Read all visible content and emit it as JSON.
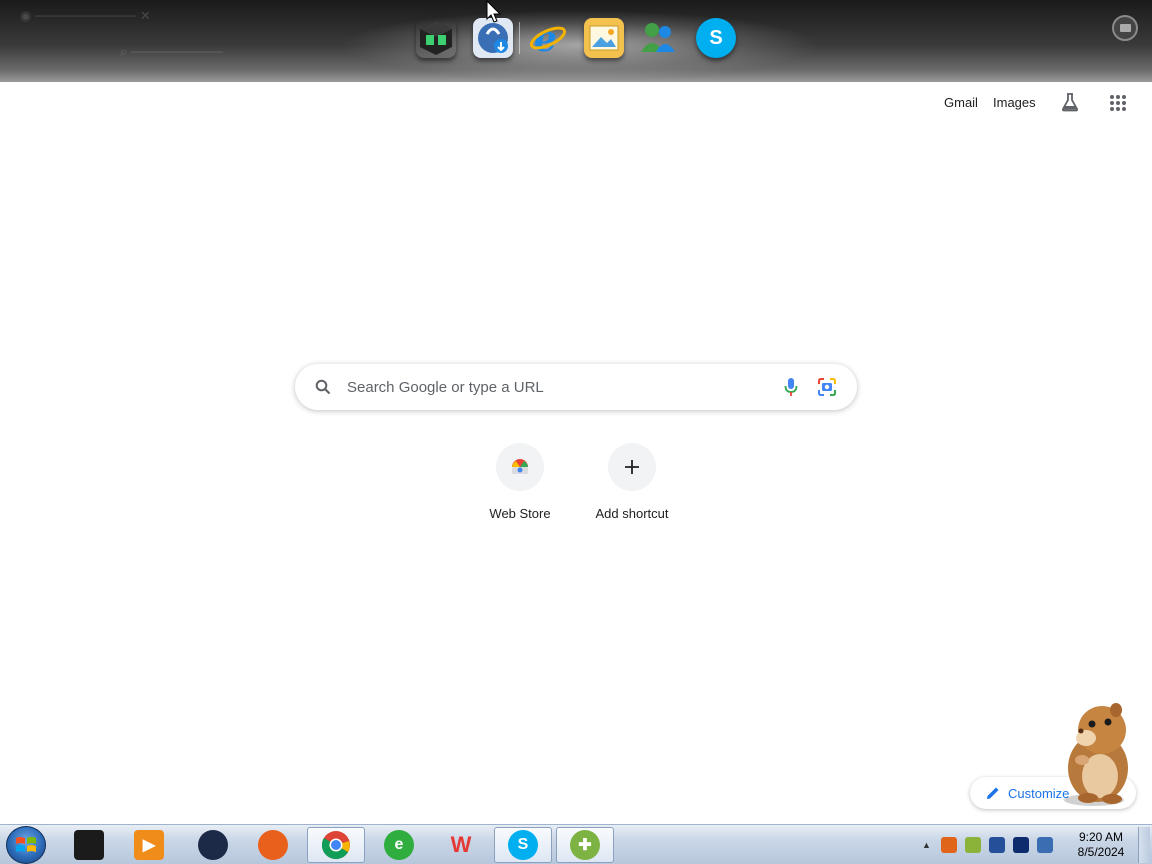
{
  "dock": {
    "icons": [
      {
        "name": "dock-app-cube-icon",
        "color": "#2e7d32"
      },
      {
        "name": "dock-app-download-icon",
        "color": "#1565c0"
      },
      {
        "name": "dock-app-ie-icon",
        "color": "#1e88e5"
      },
      {
        "name": "dock-app-photos-icon",
        "color": "#f2c14e"
      },
      {
        "name": "dock-app-messenger-icon",
        "color": "#43a047"
      },
      {
        "name": "dock-app-skype-icon",
        "color": "#00aff0"
      }
    ]
  },
  "header": {
    "gmail": "Gmail",
    "images": "Images"
  },
  "search": {
    "placeholder": "Search Google or type a URL"
  },
  "shortcuts": [
    {
      "label": "Web Store",
      "icon": "webstore-icon"
    },
    {
      "label": "Add shortcut",
      "icon": "plus-icon"
    }
  ],
  "customize": {
    "label": "Customize"
  },
  "taskbar": {
    "apps": [
      {
        "name": "taskbar-app-terminal",
        "icon": "terminal-icon",
        "color": "#1b1b1b",
        "glyph": "",
        "active": false
      },
      {
        "name": "taskbar-app-media",
        "icon": "media-player-icon",
        "color": "#f08c1a",
        "glyph": "▶",
        "active": false
      },
      {
        "name": "taskbar-app-globe",
        "icon": "globe-icon",
        "color": "#1c2a48",
        "glyph": "",
        "active": false
      },
      {
        "name": "taskbar-app-firefox",
        "icon": "firefox-icon",
        "color": "#e8601c",
        "glyph": "",
        "active": false
      },
      {
        "name": "taskbar-app-chrome",
        "icon": "chrome-icon",
        "color": "#db4437",
        "glyph": "",
        "active": true
      },
      {
        "name": "taskbar-app-ie",
        "icon": "edge-legacy-icon",
        "color": "#2fae3f",
        "glyph": "e",
        "active": false
      },
      {
        "name": "taskbar-app-wps",
        "icon": "wps-icon",
        "color": "#e53935",
        "glyph": "W",
        "active": false
      },
      {
        "name": "taskbar-app-skype",
        "icon": "skype-icon",
        "color": "#00aff0",
        "glyph": "S",
        "active": true
      },
      {
        "name": "taskbar-app-plus",
        "icon": "green-plus-icon",
        "color": "#7cb342",
        "glyph": "✚",
        "active": true
      }
    ],
    "tray_colors": [
      "#e0651a",
      "#8bb33a",
      "#264f9a",
      "#0d2c6e",
      "#3b6db3"
    ],
    "time": "9:20 AM",
    "date": "8/5/2024"
  }
}
